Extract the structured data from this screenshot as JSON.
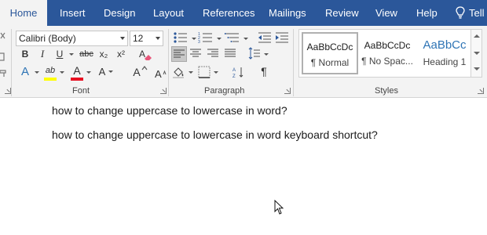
{
  "tabs": [
    {
      "label": "Home",
      "active": true
    },
    {
      "label": "Insert"
    },
    {
      "label": "Design"
    },
    {
      "label": "Layout"
    },
    {
      "label": "References"
    },
    {
      "label": "Mailings"
    },
    {
      "label": "Review"
    },
    {
      "label": "View"
    },
    {
      "label": "Help"
    }
  ],
  "tell_me": {
    "label": "Tell",
    "icon": "lightbulb-icon"
  },
  "font_group": {
    "label": "Font",
    "font_name": "Calibri (Body)",
    "font_size": "12",
    "bold": "B",
    "italic": "I",
    "underline": "U",
    "strikethrough": "abc",
    "subscript": "x₂",
    "superscript": "x²",
    "grow_font": "A",
    "shrink_font": "A",
    "font_color_letter": "A",
    "highlight_letter": "ab",
    "text_effects_letter": "A",
    "font_color_hex": "#e81123",
    "highlight_hex": "#ffff00"
  },
  "paragraph_group": {
    "label": "Paragraph",
    "show_marks": "¶",
    "active_alignment": "align-left"
  },
  "styles_group": {
    "label": "Styles",
    "styles": [
      {
        "sample": "AaBbCcDc",
        "name": "¶ Normal",
        "selected": true
      },
      {
        "sample": "AaBbCcDc",
        "name": "¶ No Spac..."
      },
      {
        "sample": "AaBbCc",
        "name": "Heading 1"
      }
    ]
  },
  "document": {
    "lines": [
      "how to change uppercase to lowercase in word?",
      "how to change uppercase to lowercase in word keyboard shortcut?"
    ]
  },
  "colors": {
    "tab_bar": "#2b579a",
    "ribbon": "#f3f3f3",
    "heading_blue": "#2e74b5"
  }
}
